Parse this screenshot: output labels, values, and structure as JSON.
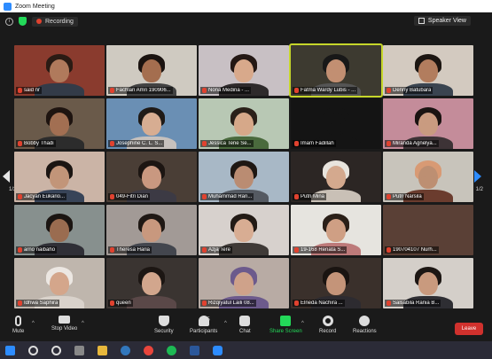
{
  "window": {
    "title": "Zoom Meeting"
  },
  "topbar": {
    "recording_label": "Recording",
    "view_label": "Speaker View"
  },
  "pagination": {
    "left": "1/2",
    "right": "1/2"
  },
  "participants": [
    {
      "name": "said nr",
      "bg": "#8a3b2e",
      "skin": "#b07a5c",
      "hair": "#2a1b14",
      "shirt": "#333b48"
    },
    {
      "name": "Fachlan Amri 190906...",
      "bg": "#cfcac1",
      "skin": "#a46e4f",
      "hair": "#1a1310",
      "shirt": "#424242"
    },
    {
      "name": "Nona Medina - ...",
      "bg": "#c8c0c4",
      "skin": "#d8a98b",
      "hair": "#241814",
      "shirt": "#2e2a2b"
    },
    {
      "name": "Fatma Wardy Lubis - ...",
      "bg": "#3d3a30",
      "skin": "#c28f72",
      "hair": "#181818",
      "shirt": "#555"
    },
    {
      "name": "Denny Batubara",
      "bg": "#d3cac0",
      "skin": "#b27d5e",
      "hair": "#1c1612",
      "shirt": "#3a4450"
    },
    {
      "name": "Bobby Thadi",
      "bg": "#6a5a4a",
      "skin": "#a26f52",
      "hair": "#1e1410",
      "shirt": "#2c2c2c"
    },
    {
      "name": "Josephine C. L. S...",
      "bg": "#6a8fb4",
      "skin": "#d7ad92",
      "hair": "#1f1a17",
      "shirt": "#c7c1bd"
    },
    {
      "name": "Jessica Tene Se...",
      "bg": "#b8c8b4",
      "skin": "#d6a889",
      "hair": "#2a2019",
      "shirt": "#4a6a3d"
    },
    {
      "name": "Imam Fadillah",
      "bg": "#141414",
      "skin": "#141414",
      "hair": "#141414",
      "shirt": "#141414"
    },
    {
      "name": "Miranda Agnelya...",
      "bg": "#c48c9a",
      "skin": "#c99b80",
      "hair": "#1a1311",
      "shirt": "#3d3336"
    },
    {
      "name": "Jacyan Eukario...",
      "bg": "#cbb4a6",
      "skin": "#c29579",
      "hair": "#1b1512",
      "shirt": "#384458"
    },
    {
      "name": "049-Fitri Dian",
      "bg": "#4a3e36",
      "skin": "#c99880",
      "hair": "#1c1512",
      "shirt": "#3c3a44"
    },
    {
      "name": "Muhammad Ran...",
      "bg": "#a8b8c6",
      "skin": "#ba8c72",
      "hair": "#1e1713",
      "shirt": "#555a62"
    },
    {
      "name": "Putri Mina",
      "bg": "#2c2624",
      "skin": "#d4a98e",
      "hair": "#e8e4dd",
      "shirt": "#c9c0b6"
    },
    {
      "name": "Putri Narsila",
      "bg": "#c8c4bb",
      "skin": "#bd8f72",
      "hair": "#d89a74",
      "shirt": "#6b3c2e"
    },
    {
      "name": "arno naibaho",
      "bg": "#87908e",
      "skin": "#9a6c50",
      "hair": "#1b1512",
      "shirt": "#2f2f36"
    },
    {
      "name": "Theresa Haria",
      "bg": "#a29a96",
      "skin": "#c8987e",
      "hair": "#1f1814",
      "shirt": "#43464e"
    },
    {
      "name": "Azja Tere",
      "bg": "#d7d1cd",
      "skin": "#d8ad93",
      "hair": "#221a15",
      "shirt": "#3f3a37"
    },
    {
      "name": "19-168 Renata S...",
      "bg": "#e6e4df",
      "skin": "#cf9f84",
      "hair": "#2a1f18",
      "shirt": "#bd7a7a"
    },
    {
      "name": "190704107 Nurh...",
      "bg": "#5a4036",
      "skin": "#5a4036",
      "hair": "#5a4036",
      "shirt": "#5a4036"
    },
    {
      "name": "Idhwa Saphira",
      "bg": "#bfb6ad",
      "skin": "#d4a68b",
      "hair": "#ece7e2",
      "shirt": "#d9d2cb"
    },
    {
      "name": "queen",
      "bg": "#3a3431",
      "skin": "#d2a68d",
      "hair": "#1c1613",
      "shirt": "#5a4848"
    },
    {
      "name": "Rizqiyatul Laili 08...",
      "bg": "#b8aba4",
      "skin": "#cfa28a",
      "hair": "#6c5a8c",
      "shirt": "#6c5a8c"
    },
    {
      "name": "Elneda Nachira ...",
      "bg": "#3a302b",
      "skin": "#c49479",
      "hair": "#1a1411",
      "shirt": "#2d2b30"
    },
    {
      "name": "Salsabila Rania B...",
      "bg": "#d4cfc9",
      "skin": "#c99a7e",
      "hair": "#1c1613",
      "shirt": "#2e2e33"
    }
  ],
  "toolbar": {
    "mute": "Mute",
    "video": "Stop Video",
    "security": "Security",
    "participants": "Participants",
    "participants_count": "35",
    "chat": "Chat",
    "share": "Share Screen",
    "record": "Record",
    "reactions": "Reactions",
    "leave": "Leave"
  },
  "colors": {
    "accent": "#2d8cff",
    "leave": "#d0312d",
    "active_speaker": "#c6d62a",
    "share": "#23d959"
  }
}
